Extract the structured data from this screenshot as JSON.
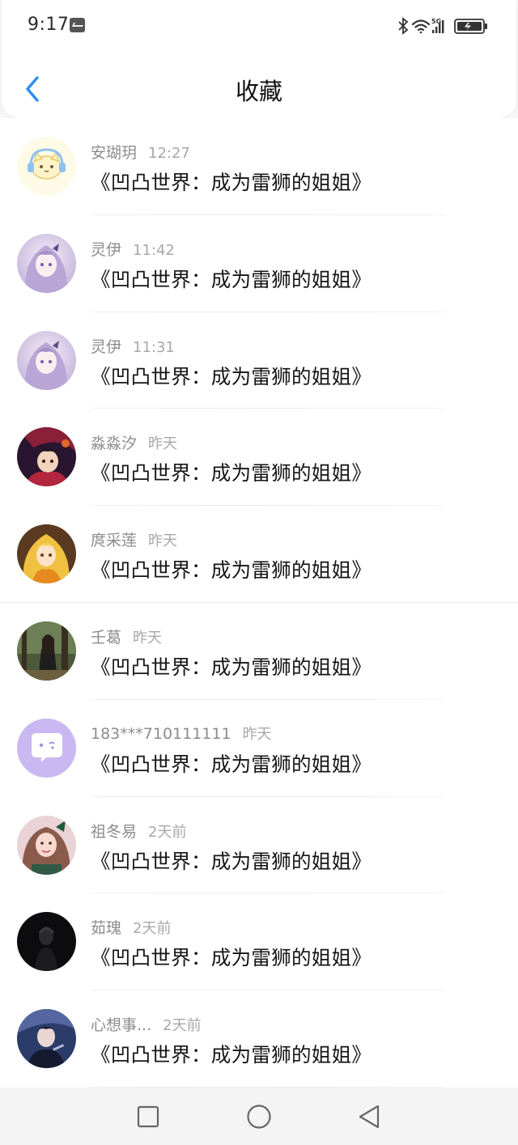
{
  "status_bar": {
    "time": "9:17",
    "network": "5G"
  },
  "header": {
    "title": "收藏"
  },
  "favorites": [
    {
      "user": "安瑚玥",
      "time": "12:27",
      "content": "《凹凸世界：成为雷狮的姐姐》",
      "avatar": "cat-headphones-avatar"
    },
    {
      "user": "灵伊",
      "time": "11:42",
      "content": "《凹凸世界：成为雷狮的姐姐》",
      "avatar": "anime-girl-lilac-avatar"
    },
    {
      "user": "灵伊",
      "time": "11:31",
      "content": "《凹凸世界：成为雷狮的姐姐》",
      "avatar": "anime-girl-lilac-avatar"
    },
    {
      "user": "淼淼汐",
      "time": "昨天",
      "content": "《凹凸世界：成为雷狮的姐姐》",
      "avatar": "anime-dark-red-avatar"
    },
    {
      "user": "庹采莲",
      "time": "昨天",
      "content": "《凹凸世界：成为雷狮的姐姐》",
      "avatar": "anime-blonde-girl-avatar"
    },
    {
      "user": "壬葛",
      "time": "昨天",
      "content": "《凹凸世界：成为雷狮的姐姐》",
      "avatar": "photo-person-forest-avatar"
    },
    {
      "user": "183***710111111",
      "time": "昨天",
      "content": "《凹凸世界：成为雷狮的姐姐》",
      "avatar": "default-chat-bubble-avatar"
    },
    {
      "user": "祖冬易",
      "time": "2天前",
      "content": "《凹凸世界：成为雷狮的姐姐》",
      "avatar": "photo-girl-pink-avatar"
    },
    {
      "user": "茹瑰",
      "time": "2天前",
      "content": "《凹凸世界：成为雷狮的姐姐》",
      "avatar": "photo-dark-person-avatar"
    },
    {
      "user": "心想事...",
      "time": "2天前",
      "content": "《凹凸世界：成为雷狮的姐姐》",
      "avatar": "anime-dark-blue-avatar"
    }
  ],
  "colors": {
    "accent": "#2f8cf0",
    "background": "#f6f6f7",
    "meta_text": "#8c8c8c"
  }
}
